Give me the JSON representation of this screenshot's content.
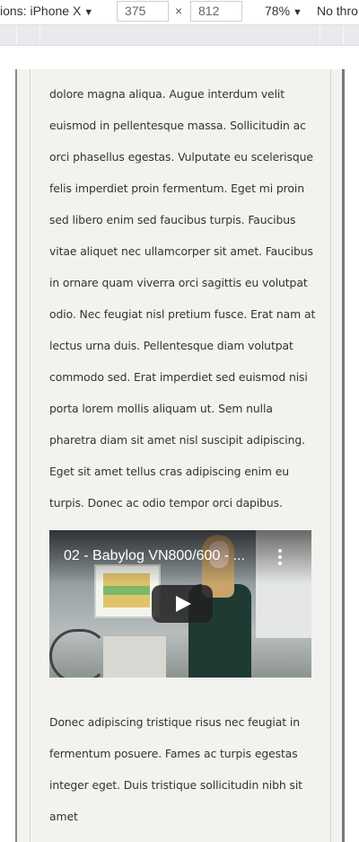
{
  "toolbar": {
    "device_label": "ions: iPhone X",
    "width_value": "375",
    "height_value": "812",
    "times_symbol": "×",
    "zoom_label": "78%",
    "throttle_label": "No thro",
    "caret": "▼"
  },
  "page": {
    "paragraph1": "dolore magna aliqua. Augue interdum velit euismod in pellentesque massa. Sollicitudin ac orci phasellus egestas. Vulputate eu scelerisque felis imperdiet proin fermentum. Eget mi proin sed libero enim sed faucibus turpis. Faucibus vitae aliquet nec ullamcorper sit amet. Faucibus in ornare quam viverra orci sagittis eu volutpat odio. Nec feugiat nisl pretium fusce. Erat nam at lectus urna duis. Pellentesque diam volutpat commodo sed. Erat imperdiet sed euismod nisi porta lorem mollis aliquam ut. Sem nulla pharetra diam sit amet nisl suscipit adipiscing. Eget sit amet tellus cras adipiscing enim eu turpis. Donec ac odio tempor orci dapibus.",
    "video": {
      "title": "02 - Babylog VN800/600 - ..."
    },
    "paragraph2": "Donec adipiscing tristique risus nec feugiat in fermentum posuere. Fames ac turpis egestas integer eget. Duis tristique sollicitudin nibh sit amet"
  }
}
